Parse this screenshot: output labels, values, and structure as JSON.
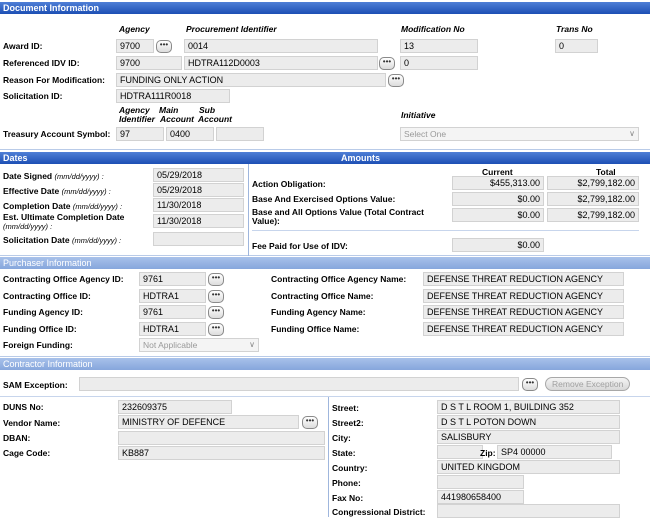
{
  "doc": {
    "header": "Document Information",
    "col_agency": "Agency",
    "col_procurement": "Procurement Identifier",
    "col_mod": "Modification No",
    "col_trans": "Trans No",
    "award_id_label": "Award ID:",
    "award_agency": "9700",
    "award_proc": "0014",
    "award_mod": "13",
    "award_trans": "0",
    "idv_label": "Referenced IDV ID:",
    "idv_agency": "9700",
    "idv_proc": "HDTRA112D0003",
    "idv_mod": "0",
    "reason_label": "Reason For Modification:",
    "reason_value": "FUNDING ONLY ACTION",
    "solicitation_label": "Solicitation ID:",
    "solicitation_value": "HDTRA111R0018",
    "tas_col1": "Agency",
    "tas_col1b": "Identifier",
    "tas_col2": "Main",
    "tas_col2b": "Account",
    "tas_col3": "Sub",
    "tas_col3b": "Account",
    "tas_label": "Treasury Account Symbol:",
    "tas_agency": "97",
    "tas_main": "0400",
    "tas_sub": "",
    "initiative_label": "Initiative",
    "initiative_value": "Select One"
  },
  "dates": {
    "header": "Dates",
    "amounts_header": "Amounts",
    "signed_label": "Date Signed",
    "signed_hint": "(mm/dd/yyyy) :",
    "signed_value": "05/29/2018",
    "effective_label": "Effective Date",
    "effective_hint": "(mm/dd/yyyy) :",
    "effective_value": "05/29/2018",
    "completion_label": "Completion Date",
    "completion_hint": "(mm/dd/yyyy) :",
    "completion_value": "11/30/2018",
    "ultimate_label": "Est. Ultimate Completion Date",
    "ultimate_hint": "(mm/dd/yyyy) :",
    "ultimate_value": "11/30/2018",
    "solicitation_label": "Solicitation Date",
    "solicitation_hint": "(mm/dd/yyyy) :",
    "solicitation_value": ""
  },
  "amounts": {
    "col_current": "Current",
    "col_total": "Total",
    "obligation_label": "Action Obligation:",
    "obligation_current": "$455,313.00",
    "obligation_total": "$2,799,182.00",
    "base_exercised_label": "Base And Exercised Options Value:",
    "base_exercised_current": "$0.00",
    "base_exercised_total": "$2,799,182.00",
    "base_all_label": "Base and All Options Value (Total Contract",
    "base_all_label2": "Value):",
    "base_all_current": "$0.00",
    "base_all_total": "$2,799,182.00",
    "fee_label": "Fee Paid for Use of IDV:",
    "fee_value": "$0.00"
  },
  "purchaser": {
    "header": "Purchaser Information",
    "co_agency_label": "Contracting Office Agency ID:",
    "co_agency_value": "9761",
    "co_agency_name_label": "Contracting Office Agency Name:",
    "co_agency_name_value": "DEFENSE THREAT REDUCTION AGENCY",
    "co_id_label": "Contracting Office ID:",
    "co_id_value": "HDTRA1",
    "co_name_label": "Contracting Office Name:",
    "co_name_value": "DEFENSE THREAT REDUCTION AGENCY",
    "fa_label": "Funding Agency ID:",
    "fa_value": "9761",
    "fa_name_label": "Funding Agency Name:",
    "fa_name_value": "DEFENSE THREAT REDUCTION AGENCY",
    "fo_label": "Funding Office ID:",
    "fo_value": "HDTRA1",
    "fo_name_label": "Funding Office Name:",
    "fo_name_value": "DEFENSE THREAT REDUCTION AGENCY",
    "foreign_label": "Foreign Funding:",
    "foreign_value": "Not Applicable"
  },
  "contractor": {
    "header": "Contractor Information",
    "sam_label": "SAM Exception:",
    "sam_value": "",
    "remove_exception": "Remove Exception",
    "duns_label": "DUNS No:",
    "duns_value": "232609375",
    "vendor_label": "Vendor Name:",
    "vendor_value": "MINISTRY OF DEFENCE",
    "dban_label": "DBAN:",
    "dban_value": "",
    "cage_label": "Cage Code:",
    "cage_value": "KB887",
    "street_label": "Street:",
    "street_value": "D S T L ROOM 1, BUILDING 352",
    "street2_label": "Street2:",
    "street2_value": "D S T L POTON DOWN",
    "city_label": "City:",
    "city_value": "SALISBURY",
    "state_label": "State:",
    "state_value": "",
    "zip_label": "Zip:",
    "zip_value": "SP4 00000",
    "country_label": "Country:",
    "country_value": "UNITED KINGDOM",
    "phone_label": "Phone:",
    "phone_value": "",
    "fax_label": "Fax No:",
    "fax_value": "441980658400",
    "congress_label": "Congressional District:",
    "congress_value": ""
  },
  "icons": {
    "ellipsis": "ellipsis-icon",
    "dropdown": "chevron-down-icon"
  },
  "colors": {
    "header_dark": "#1d4fb4",
    "header_light": "#86a6dc",
    "field_bg": "#ececec"
  }
}
